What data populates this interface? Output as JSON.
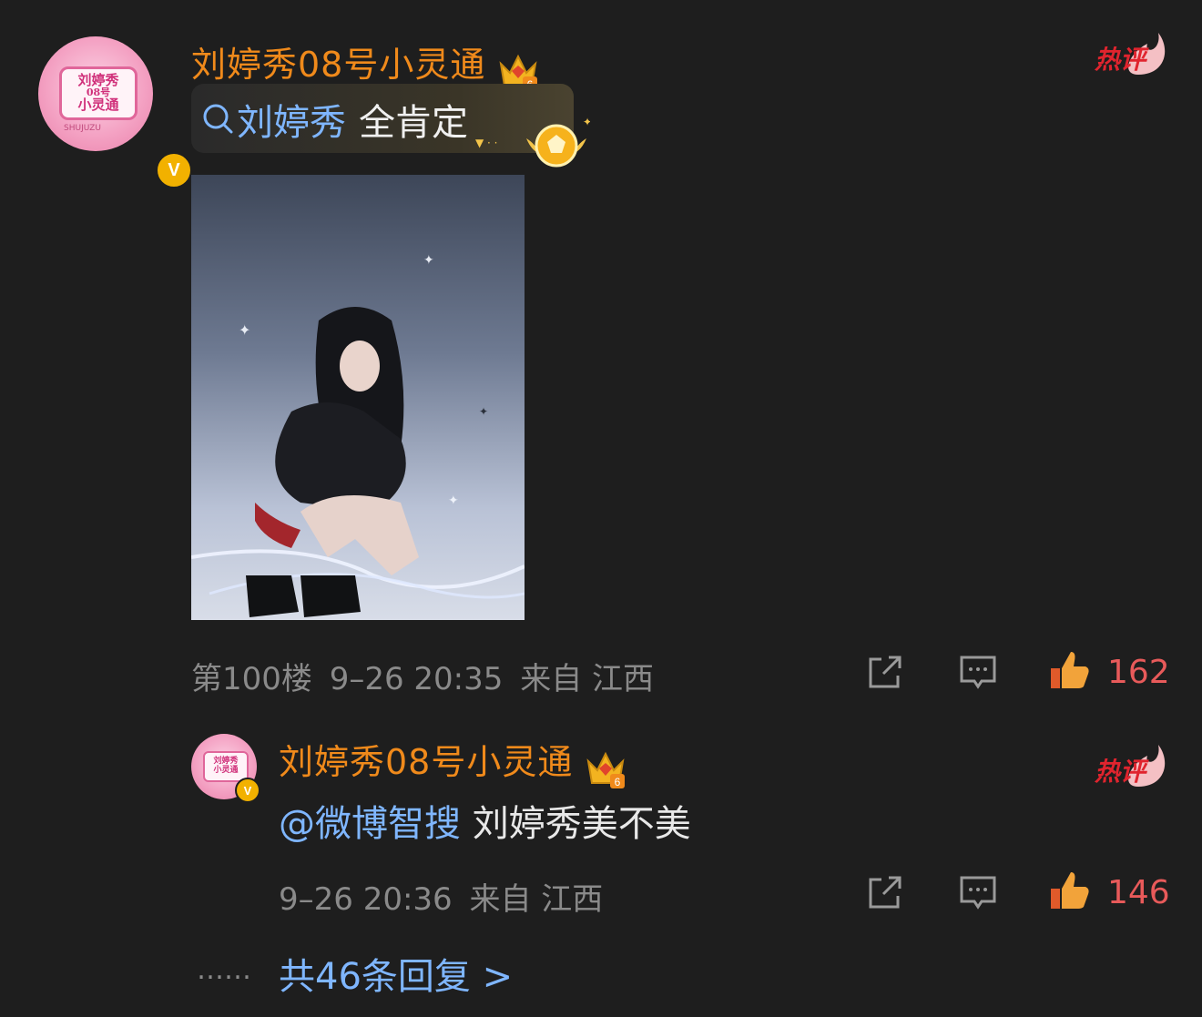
{
  "comment": {
    "avatar_text": [
      "刘婷秀",
      "08号",
      "小灵通"
    ],
    "avatar_small_text": "SHUJUZU",
    "verified": "V",
    "username": "刘婷秀08号小灵通",
    "crown_level": "6",
    "hot_label": "热评",
    "search_chip": {
      "highlight": "刘婷秀",
      "rest": "全肯定"
    },
    "photo_name": "person photo",
    "meta": {
      "floor": "第100楼",
      "time": "9–26 20:35",
      "from": "来自 江西"
    },
    "like_count": "162"
  },
  "reply": {
    "avatar_text": [
      "刘婷秀",
      "小灵通"
    ],
    "verified": "V",
    "username": "刘婷秀08号小灵通",
    "crown_level": "6",
    "hot_label": "热评",
    "mention": "@微博智搜",
    "text": " 刘婷秀美不美",
    "meta": {
      "time": "9–26 20:36",
      "from": "来自 江西"
    },
    "like_count": "146"
  },
  "footer": {
    "dots": "……",
    "more_replies": "共46条回复 >"
  },
  "colors": {
    "background": "#1e1e1e",
    "username": "#f08a1b",
    "link": "#7fb6ff",
    "like": "#e85a5a",
    "meta": "#8a8a8a"
  }
}
